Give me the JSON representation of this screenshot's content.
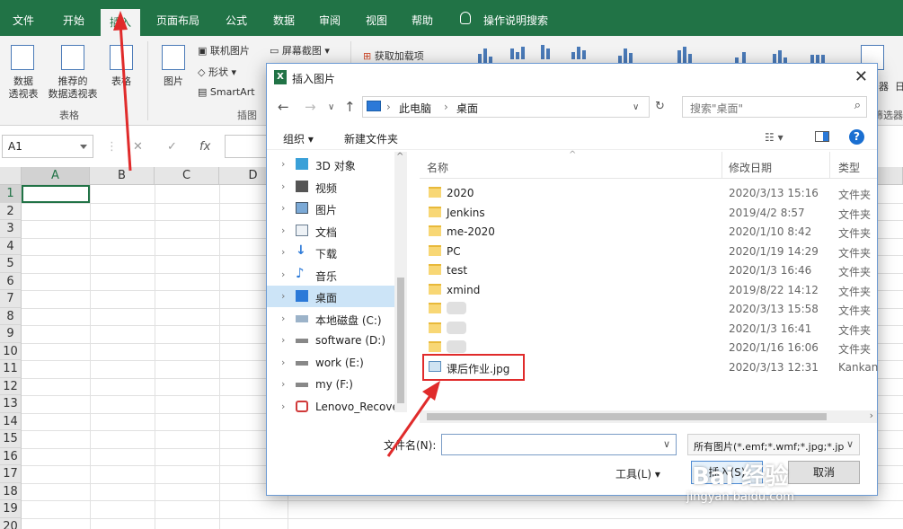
{
  "ribbon_tabs": [
    {
      "label": "文件"
    },
    {
      "label": "开始"
    },
    {
      "label": "插入"
    },
    {
      "label": "页面布局"
    },
    {
      "label": "公式"
    },
    {
      "label": "数据"
    },
    {
      "label": "审阅"
    },
    {
      "label": "视图"
    },
    {
      "label": "帮助"
    },
    {
      "label": "操作说明搜索"
    }
  ],
  "ribbon": {
    "pivot_label_1": "数据",
    "pivot_label_2": "透视表",
    "recommended_label_1": "推荐的",
    "recommended_label_2": "数据透视表",
    "table_label": "表格",
    "pictures_label": "图片",
    "online_pictures": "联机图片",
    "shapes": "形状",
    "smartart": "SmartArt",
    "screenshot": "屏幕截图",
    "get_addins": "获取加载项",
    "group_tables": "表格",
    "group_illustrations": "插图",
    "right_cut_1": "器",
    "right_cut_2": "筛选器",
    "right_cut_3": "日"
  },
  "formula_bar": {
    "name_box": "A1",
    "cancel_icon": "✕",
    "enter_icon": "✓",
    "fx_icon": "fx"
  },
  "grid": {
    "columns": [
      "A",
      "B",
      "C",
      "D"
    ],
    "rows": [
      "1",
      "2",
      "3",
      "4",
      "5",
      "6",
      "7",
      "8",
      "9",
      "10",
      "11",
      "12",
      "13",
      "14",
      "15",
      "16",
      "17",
      "18",
      "19",
      "20"
    ]
  },
  "dialog": {
    "title": "插入图片",
    "close_icon": "✕",
    "path_pc": "此电脑",
    "path_desktop": "桌面",
    "search_placeholder": "搜索\"桌面\"",
    "organize": "组织 ▾",
    "new_folder": "新建文件夹",
    "nav_items": [
      {
        "label": "3D 对象",
        "icon": "3d-objects-icon"
      },
      {
        "label": "视频",
        "icon": "video-icon"
      },
      {
        "label": "图片",
        "icon": "pictures-icon"
      },
      {
        "label": "文档",
        "icon": "documents-icon"
      },
      {
        "label": "下载",
        "icon": "downloads-icon"
      },
      {
        "label": "音乐",
        "icon": "music-icon"
      },
      {
        "label": "桌面",
        "icon": "desktop-icon"
      },
      {
        "label": "本地磁盘 (C:)",
        "icon": "drive-icon"
      },
      {
        "label": "software (D:)",
        "icon": "drive-icon"
      },
      {
        "label": "work (E:)",
        "icon": "drive-icon"
      },
      {
        "label": "my (F:)",
        "icon": "drive-icon"
      },
      {
        "label": "Lenovo_Recove",
        "icon": "lenovo-drive-icon"
      }
    ],
    "columns": {
      "name": "名称",
      "date": "修改日期",
      "type": "类型"
    },
    "files": [
      {
        "name": "2020",
        "date": "2020/3/13 15:16",
        "type": "文件夹",
        "kind": "folder"
      },
      {
        "name": "Jenkins",
        "date": "2019/4/2 8:57",
        "type": "文件夹",
        "kind": "folder"
      },
      {
        "name": "me-2020",
        "date": "2020/1/10 8:42",
        "type": "文件夹",
        "kind": "folder"
      },
      {
        "name": "PC",
        "date": "2020/1/19 14:29",
        "type": "文件夹",
        "kind": "folder"
      },
      {
        "name": "test",
        "date": "2020/1/3 16:46",
        "type": "文件夹",
        "kind": "folder"
      },
      {
        "name": "xmind",
        "date": "2019/8/22 14:12",
        "type": "文件夹",
        "kind": "folder"
      },
      {
        "name": "",
        "date": "2020/3/13 15:58",
        "type": "文件夹",
        "kind": "folder"
      },
      {
        "name": "",
        "date": "2020/1/3 16:41",
        "type": "文件夹",
        "kind": "folder"
      },
      {
        "name": "",
        "date": "2020/1/16 16:06",
        "type": "文件夹",
        "kind": "folder"
      },
      {
        "name": "课后作业.jpg",
        "date": "2020/3/13 12:31",
        "type": "Kankan",
        "kind": "image"
      }
    ],
    "filename_label": "文件名(N):",
    "filename_value": "",
    "filetype_value": "所有图片(*.emf;*.wmf;*.jpg;*.jp",
    "tools": "工具(L)",
    "open_button": "插入(S)",
    "cancel_button": "取消"
  },
  "watermark": {
    "brand": "Bai 经验",
    "url": "jingyan.baidu.com"
  },
  "colors": {
    "excel_green": "#217346",
    "highlight_red": "#e02b2b",
    "selection_blue": "#cce4f7"
  }
}
